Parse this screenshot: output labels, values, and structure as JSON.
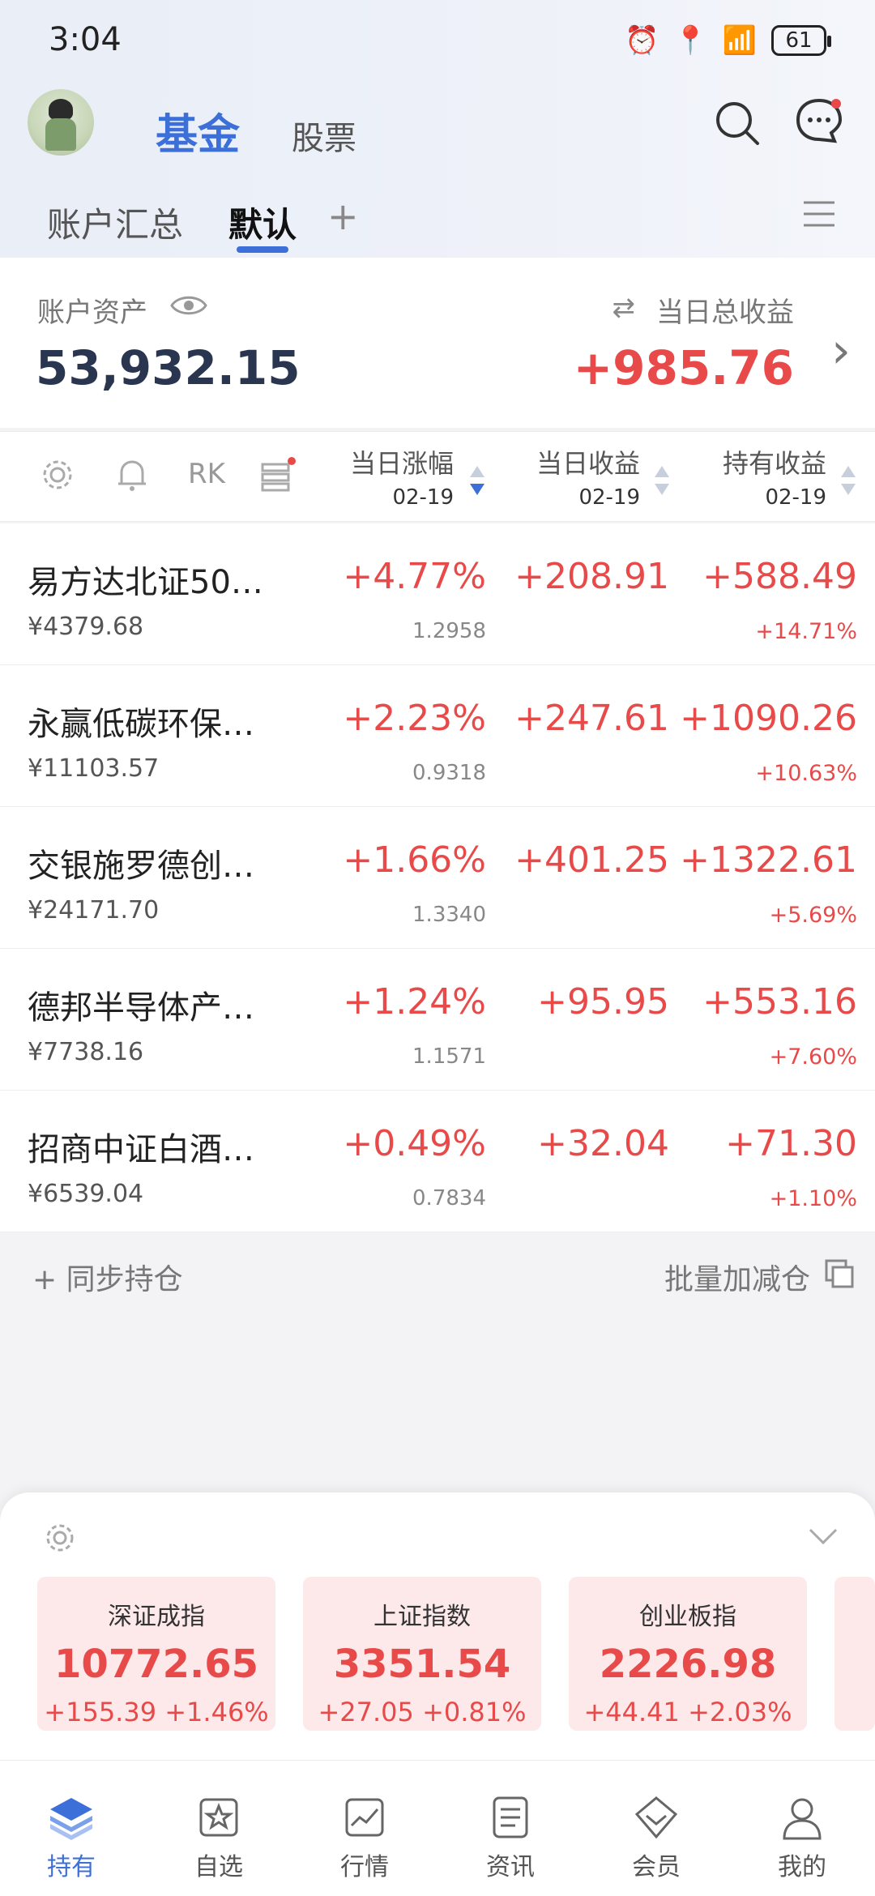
{
  "status_bar": {
    "time": "3:04",
    "battery": "61"
  },
  "header": {
    "segment_active": "基金",
    "segment_other": "股票"
  },
  "tabs": {
    "items": [
      "账户汇总",
      "默认"
    ],
    "active": "默认",
    "add": "+"
  },
  "summary": {
    "asset_label": "账户资产",
    "asset_value": "53,932.15",
    "daily_label": "当日总收益",
    "daily_value": "+985.76"
  },
  "columns": [
    {
      "title": "当日涨幅",
      "date": "02-19"
    },
    {
      "title": "当日收益",
      "date": "02-19"
    },
    {
      "title": "持有收益",
      "date": "02-19"
    }
  ],
  "funds": [
    {
      "name": "易方达北证50…",
      "amount": "¥4379.68",
      "change": "+4.77%",
      "nav": "1.2958",
      "daily": "+208.91",
      "hold": "+588.49",
      "hold_pct": "+14.71%"
    },
    {
      "name": "永赢低碳环保…",
      "amount": "¥11103.57",
      "change": "+2.23%",
      "nav": "0.9318",
      "daily": "+247.61",
      "hold": "+1090.26",
      "hold_pct": "+10.63%"
    },
    {
      "name": "交银施罗德创…",
      "amount": "¥24171.70",
      "change": "+1.66%",
      "nav": "1.3340",
      "daily": "+401.25",
      "hold": "+1322.61",
      "hold_pct": "+5.69%"
    },
    {
      "name": "德邦半导体产…",
      "amount": "¥7738.16",
      "change": "+1.24%",
      "nav": "1.1571",
      "daily": "+95.95",
      "hold": "+553.16",
      "hold_pct": "+7.60%"
    },
    {
      "name": "招商中证白酒…",
      "amount": "¥6539.04",
      "change": "+0.49%",
      "nav": "0.7834",
      "daily": "+32.04",
      "hold": "+71.30",
      "hold_pct": "+1.10%"
    }
  ],
  "actions": {
    "sync": "+ 同步持仓",
    "batch": "批量加减仓"
  },
  "indices": [
    {
      "name": "深证成指",
      "value": "10772.65",
      "change": "+155.39  +1.46%"
    },
    {
      "name": "上证指数",
      "value": "3351.54",
      "change": "+27.05  +0.81%"
    },
    {
      "name": "创业板指",
      "value": "2226.98",
      "change": "+44.41  +2.03%"
    }
  ],
  "tabbar": [
    {
      "label": "持有",
      "icon": "layers-icon"
    },
    {
      "label": "自选",
      "icon": "star-icon"
    },
    {
      "label": "行情",
      "icon": "chart-icon"
    },
    {
      "label": "资讯",
      "icon": "news-icon"
    },
    {
      "label": "会员",
      "icon": "diamond-icon"
    },
    {
      "label": "我的",
      "icon": "user-icon"
    }
  ],
  "colors": {
    "accent": "#3d6fd8",
    "up": "#e84a4a",
    "index_bg": "#fde9ea"
  }
}
